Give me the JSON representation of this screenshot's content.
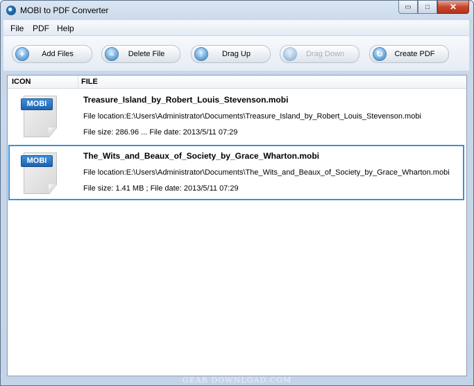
{
  "window": {
    "title": "MOBI to PDF Converter",
    "controls": {
      "minimize": "▭",
      "maximize": "□",
      "close": "✕"
    }
  },
  "menu": {
    "items": [
      "File",
      "PDF",
      "Help"
    ]
  },
  "toolbar": {
    "buttons": [
      {
        "label": "Add Files",
        "icon": "plus-icon",
        "glyph": "+",
        "enabled": true
      },
      {
        "label": "Delete File",
        "icon": "minus-icon",
        "glyph": "–",
        "enabled": true
      },
      {
        "label": "Drag Up",
        "icon": "arrow-up-icon",
        "glyph": "↑",
        "enabled": true
      },
      {
        "label": "Drag Down",
        "icon": "arrow-down-icon",
        "glyph": "↓",
        "enabled": false
      },
      {
        "label": "Create PDF",
        "icon": "refresh-icon",
        "glyph": "↻",
        "enabled": true
      }
    ]
  },
  "list": {
    "columns": [
      "ICON",
      "FILE"
    ],
    "badge": "MOBI",
    "rows": [
      {
        "name": "Treasure_Island_by_Robert_Louis_Stevenson.mobi",
        "location": "File location:E:\\Users\\Administrator\\Documents\\Treasure_Island_by_Robert_Louis_Stevenson.mobi",
        "info": "File size: 286.96 ...  File date: 2013/5/11 07:29",
        "selected": false
      },
      {
        "name": "The_Wits_and_Beaux_of_Society_by_Grace_Wharton.mobi",
        "location": "File location:E:\\Users\\Administrator\\Documents\\The_Wits_and_Beaux_of_Society_by_Grace_Wharton.mobi",
        "info": "File size: 1.41 MB ;  File date: 2013/5/11 07:29",
        "selected": true
      }
    ]
  },
  "watermark": "GEAR DOWNLOAD.COM",
  "colors": {
    "selection": "#3f8fd8",
    "badge": "#1e64b0",
    "close": "#c7452c"
  }
}
